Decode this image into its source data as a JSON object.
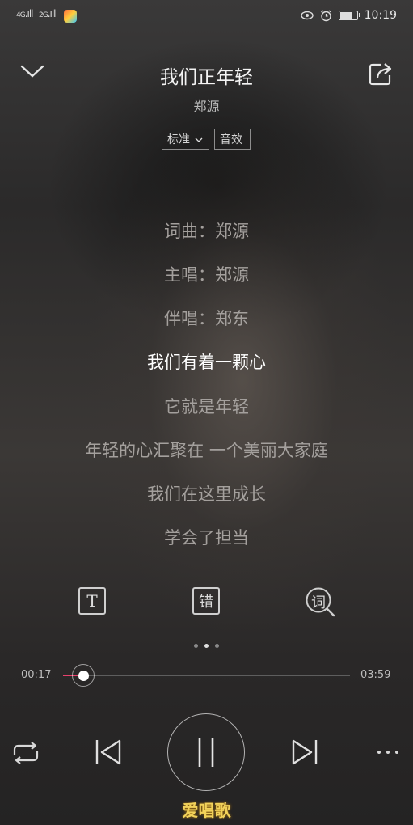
{
  "status_bar": {
    "signal1_label": "4G",
    "signal2_label": "2G",
    "time": "10:19"
  },
  "song": {
    "title": "我们正年轻",
    "artist": "郑源"
  },
  "chips": {
    "quality": "标准",
    "effect": "音效"
  },
  "lyrics": [
    {
      "text": "词曲：郑源",
      "active": false
    },
    {
      "text": "主唱：郑源",
      "active": false
    },
    {
      "text": "伴唱：郑东",
      "active": false
    },
    {
      "text": "我们有着一颗心",
      "active": true
    },
    {
      "text": "它就是年轻",
      "active": false
    },
    {
      "text": "年轻的心汇聚在 一个美丽大家庭",
      "active": false
    },
    {
      "text": "我们在这里成长",
      "active": false
    },
    {
      "text": "学会了担当",
      "active": false
    }
  ],
  "tools": {
    "font_glyph": "T",
    "error_glyph": "错",
    "lyrics_glyph": "词"
  },
  "page_indicator": {
    "count": 3,
    "current": 2
  },
  "progress": {
    "elapsed": "00:17",
    "total": "03:59",
    "fraction": 0.071
  },
  "watermark": "爱唱歌"
}
